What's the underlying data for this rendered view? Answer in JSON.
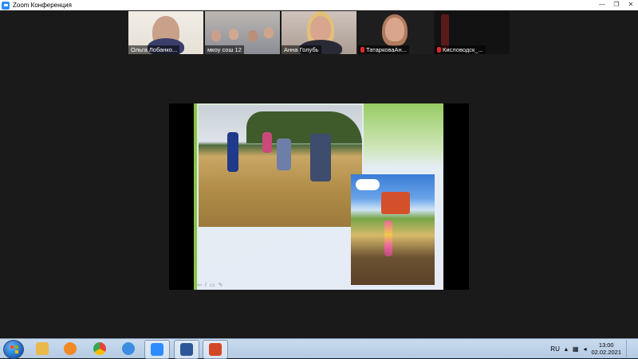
{
  "window": {
    "title": "Zoom Конференция",
    "controls": [
      "—",
      "❐",
      "✕"
    ]
  },
  "participants": [
    {
      "name": "Ольга Лобанко...",
      "muted": false
    },
    {
      "name": "мкоу сош 12",
      "muted": false
    },
    {
      "name": "Анна Голубь",
      "muted": false
    },
    {
      "name": "ТатарковаАн...",
      "muted": true
    },
    {
      "name": "Кисловодск_...",
      "muted": true
    }
  ],
  "slide_toolbar": [
    "⇦",
    "/",
    "▭",
    "✎"
  ],
  "taskbar": {
    "apps": [
      {
        "name": "explorer-icon",
        "color": "#e8b84a"
      },
      {
        "name": "media-player-icon",
        "color": "#f08a24"
      },
      {
        "name": "chrome-icon",
        "color": "#2f9e44"
      },
      {
        "name": "ie-icon",
        "color": "#3a8de0"
      },
      {
        "name": "zoom-icon",
        "color": "#2d8cff"
      },
      {
        "name": "word-icon",
        "color": "#2b579a"
      },
      {
        "name": "powerpoint-icon",
        "color": "#d24726"
      }
    ],
    "language": "RU",
    "time": "13:00",
    "date": "02.02.2021"
  }
}
